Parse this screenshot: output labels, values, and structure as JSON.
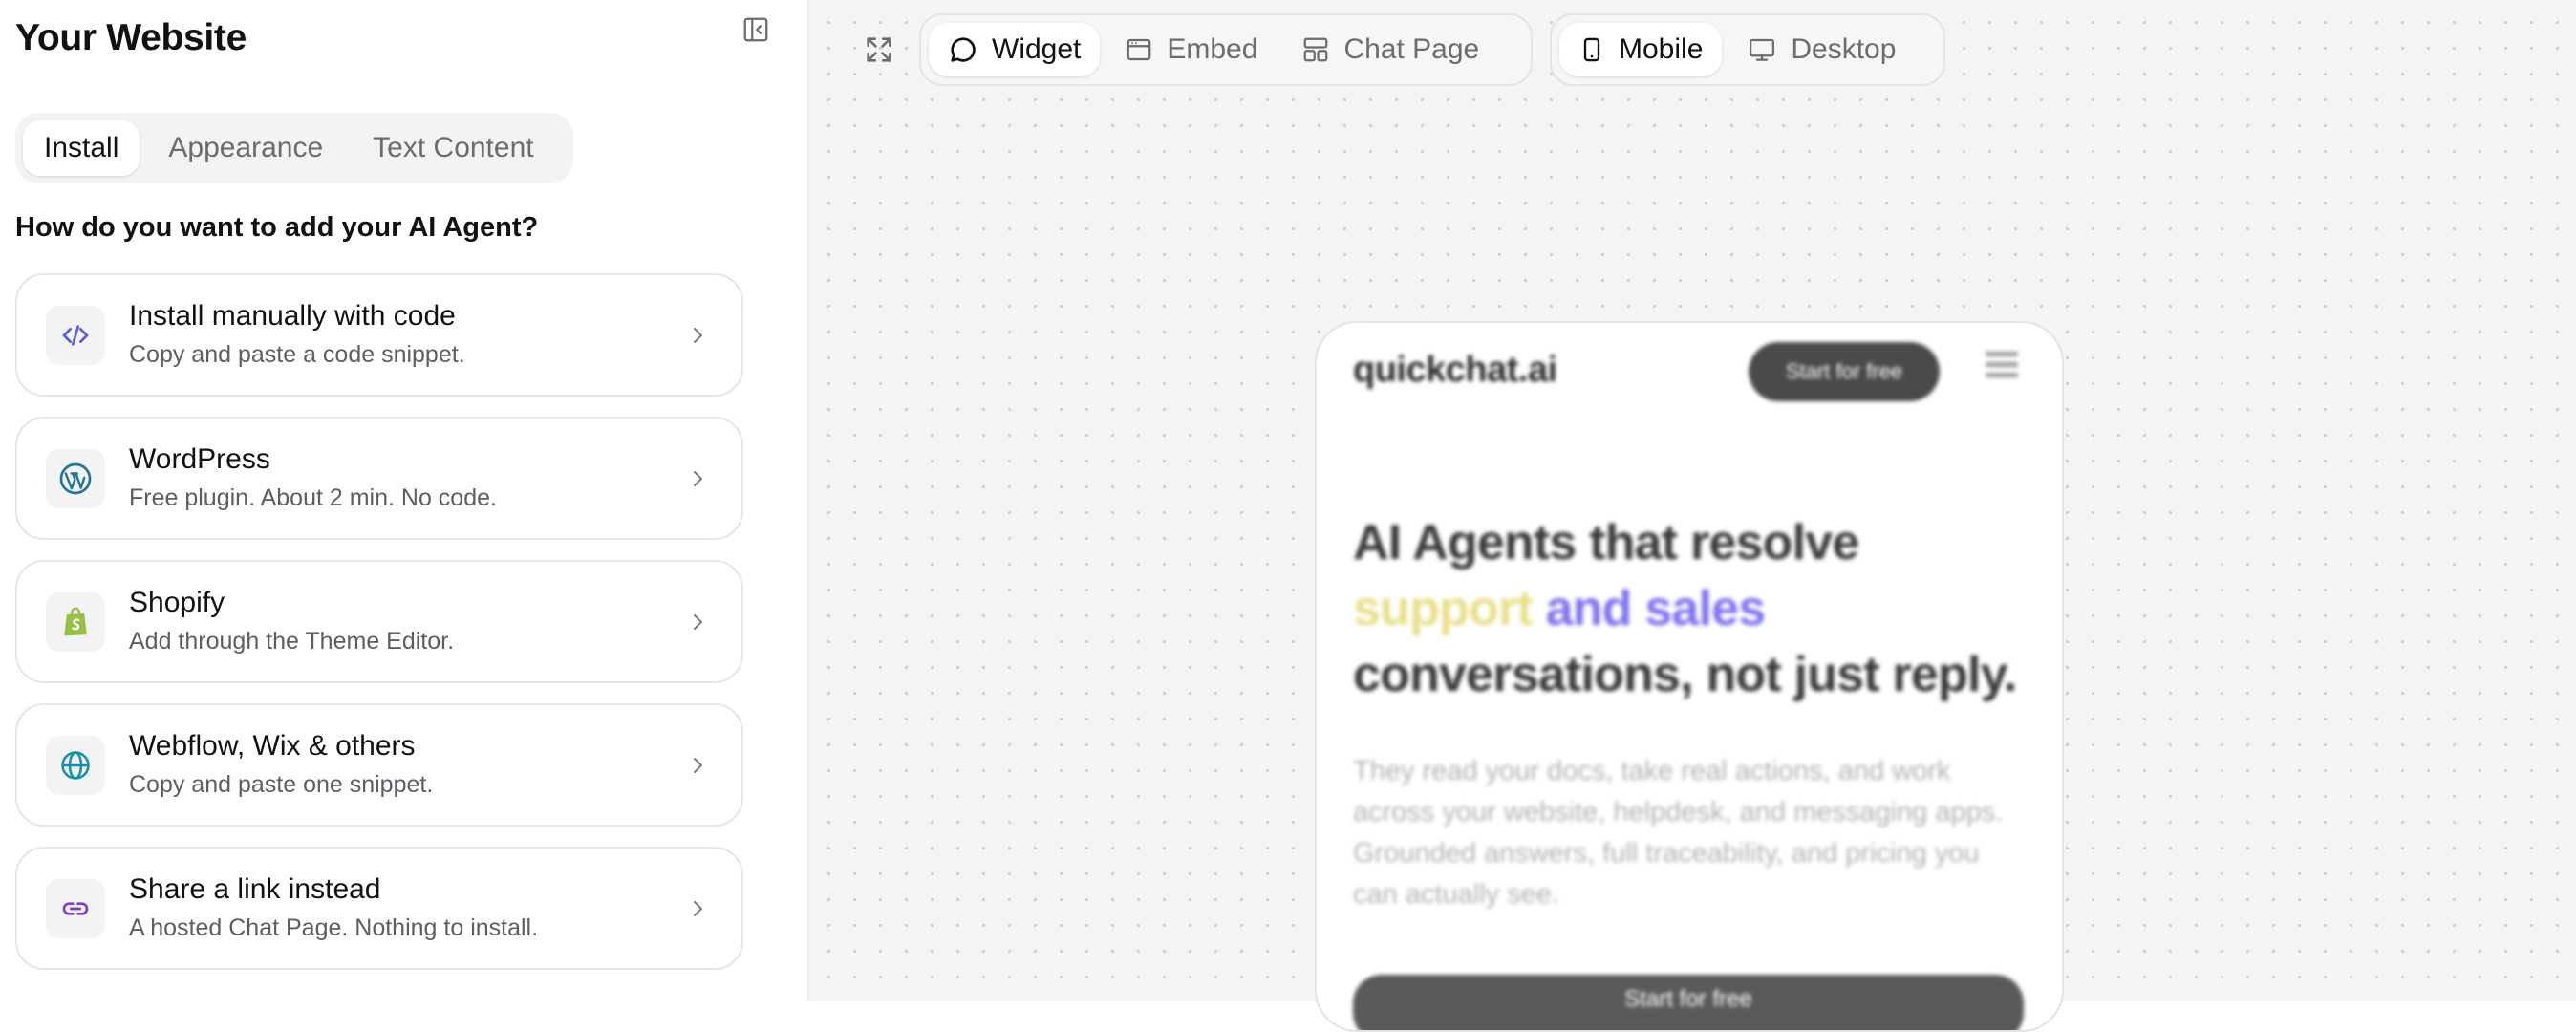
{
  "sidebar": {
    "title": "Your Website",
    "tabs": [
      {
        "label": "Install",
        "active": true
      },
      {
        "label": "Appearance",
        "active": false
      },
      {
        "label": "Text Content",
        "active": false
      }
    ],
    "question": "How do you want to add your AI Agent?",
    "options": [
      {
        "title": "Install manually with code",
        "desc": "Copy and paste a code snippet.",
        "icon": "code-icon"
      },
      {
        "title": "WordPress",
        "desc": "Free plugin. About 2 min. No code.",
        "icon": "wordpress-icon"
      },
      {
        "title": "Shopify",
        "desc": "Add through the Theme Editor.",
        "icon": "shopify-icon"
      },
      {
        "title": "Webflow, Wix & others",
        "desc": "Copy and paste one snippet.",
        "icon": "globe-icon"
      },
      {
        "title": "Share a link instead",
        "desc": "A hosted Chat Page. Nothing to install.",
        "icon": "link-icon"
      }
    ]
  },
  "toolbar": {
    "modes": [
      {
        "label": "Widget",
        "active": true,
        "icon": "chat-bubble-icon"
      },
      {
        "label": "Embed",
        "active": false,
        "icon": "browser-window-icon"
      },
      {
        "label": "Chat Page",
        "active": false,
        "icon": "layout-icon"
      }
    ],
    "devices": [
      {
        "label": "Mobile",
        "active": true,
        "icon": "smartphone-icon"
      },
      {
        "label": "Desktop",
        "active": false,
        "icon": "monitor-icon"
      }
    ]
  },
  "preview": {
    "brand": "quickchat.ai",
    "nav_cta": "Start for free",
    "headline_1": "AI Agents that resolve",
    "headline_hl1": "support",
    "headline_hl2": " and sales",
    "headline_3": "conversations, not just reply.",
    "subtext": "They read your docs, take real actions, and work across your website, helpdesk, and messaging apps. Grounded answers, full traceability, and pricing you can actually see.",
    "cta": "Start for free"
  },
  "colors": {
    "accent_code": "#5b5bd6",
    "wordpress": "#21759b",
    "shopify": "#95bf47",
    "globe": "#1a8fa8",
    "link": "#7b3fc4",
    "highlight_yellow": "#e8df8a",
    "highlight_purple": "#7c73ee"
  }
}
